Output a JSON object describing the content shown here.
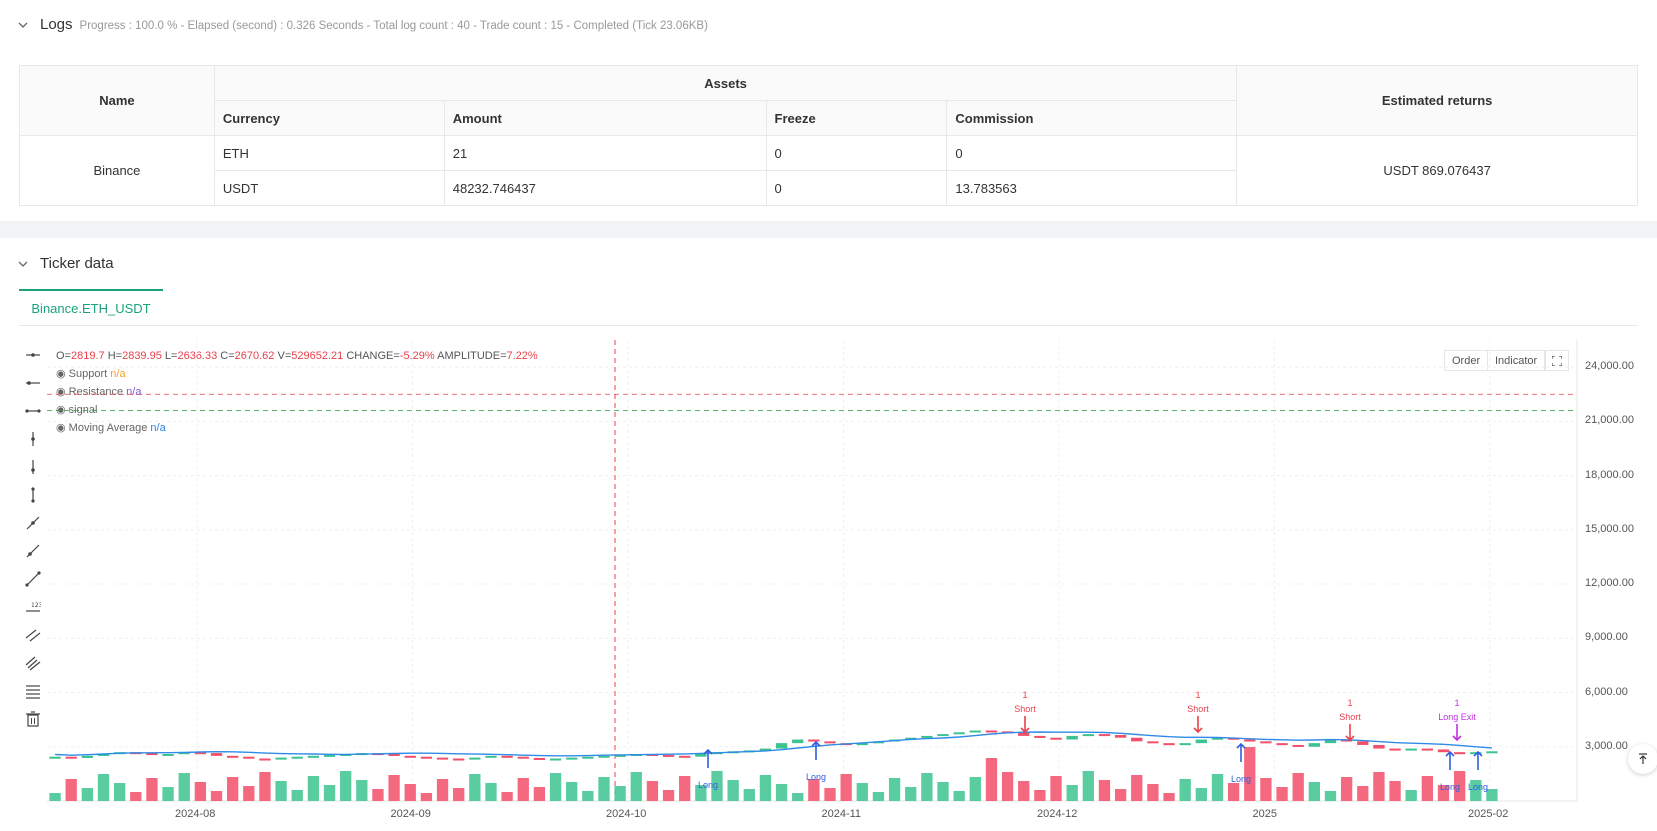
{
  "logs": {
    "title": "Logs",
    "status": "Progress : 100.0 % - Elapsed (second) : 0.326  Seconds - Total log count : 40 - Trade count : 15 - Completed (Tick 23.06KB)"
  },
  "assets_table": {
    "name_header": "Name",
    "assets_header": "Assets",
    "returns_header": "Estimated returns",
    "columns": [
      "Currency",
      "Amount",
      "Freeze",
      "Commission"
    ],
    "exchange": "Binance",
    "rows": [
      {
        "currency": "ETH",
        "amount": "21",
        "freeze": "0",
        "commission": "0"
      },
      {
        "currency": "USDT",
        "amount": "48232.746437",
        "freeze": "0",
        "commission": "13.783563"
      }
    ],
    "estimated_returns": "USDT 869.076437"
  },
  "ticker": {
    "title": "Ticker data",
    "tab": "Binance.ETH_USDT"
  },
  "ohlc": {
    "o_label": "O=",
    "o": "2819.7",
    "h_label": "H=",
    "h": "2839.95",
    "l_label": "L=",
    "l": "2636.33",
    "c_label": "C=",
    "c": "2670.62",
    "v_label": "V=",
    "v": "529652.21",
    "change_label": "CHANGE=",
    "change": "-5.29%",
    "amp_label": "AMPLITUDE=",
    "amp": "7.22%"
  },
  "legend": [
    {
      "name": "Support",
      "value": "n/a",
      "color": "#f0a030"
    },
    {
      "name": "Resistance",
      "value": "n/a",
      "color": "#7b5cd6"
    },
    {
      "name": "signal",
      "value": "",
      "color": "#999999"
    },
    {
      "name": "Moving Average",
      "value": "n/a",
      "color": "#2f7fe0"
    }
  ],
  "buttons": {
    "order": "Order",
    "indicator": "Indicator"
  },
  "colors": {
    "up": "#3cc38f",
    "down": "#f24f68",
    "ma": "#2f8be6",
    "long": "#2f5fe0",
    "short": "#e8414b",
    "exit": "#c230e0",
    "accent": "#1aa37a"
  },
  "chart_data": {
    "type": "candlestick",
    "y_ticks": [
      "24,000.00",
      "21,000.00",
      "18,000.00",
      "15,000.00",
      "12,000.00",
      "9,000.00",
      "6,000.00",
      "3,000.00"
    ],
    "x_ticks": [
      "2024-08",
      "2024-09",
      "2024-10",
      "2024-11",
      "2024-12",
      "2025",
      "2025-02"
    ],
    "ylim": [
      0,
      25500
    ],
    "resistance_level": 22500,
    "support_level": 21600,
    "markers": [
      {
        "label": "1",
        "text": "Short",
        "kind": "short"
      },
      {
        "label": "1",
        "text": "Short",
        "kind": "short"
      },
      {
        "label": "1",
        "text": "Short",
        "kind": "short"
      },
      {
        "label": "1",
        "text": "Long Exit",
        "kind": "exit"
      },
      {
        "label": "",
        "text": "Long",
        "kind": "long"
      },
      {
        "label": "",
        "text": "Long",
        "kind": "long"
      },
      {
        "label": "",
        "text": "Long",
        "kind": "long"
      },
      {
        "label": "",
        "text": "Long",
        "kind": "long"
      },
      {
        "label": "",
        "text": "Long",
        "kind": "long"
      }
    ],
    "price_path": [
      2450,
      2380,
      2500,
      2600,
      2700,
      2650,
      2550,
      2600,
      2700,
      2650,
      2500,
      2450,
      2350,
      2300,
      2400,
      2450,
      2500,
      2550,
      2600,
      2650,
      2600,
      2500,
      2450,
      2400,
      2350,
      2300,
      2400,
      2500,
      2450,
      2380,
      2300,
      2350,
      2400,
      2450,
      2500,
      2550,
      2600,
      2550,
      2500,
      2450,
      2600,
      2700,
      2750,
      2800,
      2900,
      3200,
      3400,
      3300,
      3200,
      3100,
      3200,
      3300,
      3400,
      3500,
      3600,
      3700,
      3800,
      3900,
      3850,
      3800,
      3600,
      3500,
      3400,
      3600,
      3700,
      3650,
      3500,
      3300,
      3200,
      3100,
      3200,
      3400,
      3500,
      3400,
      3300,
      3200,
      3100,
      3000,
      3200,
      3400,
      3300,
      3100,
      2900,
      2800,
      2900,
      2850,
      2700,
      2650,
      2700,
      2750
    ]
  }
}
